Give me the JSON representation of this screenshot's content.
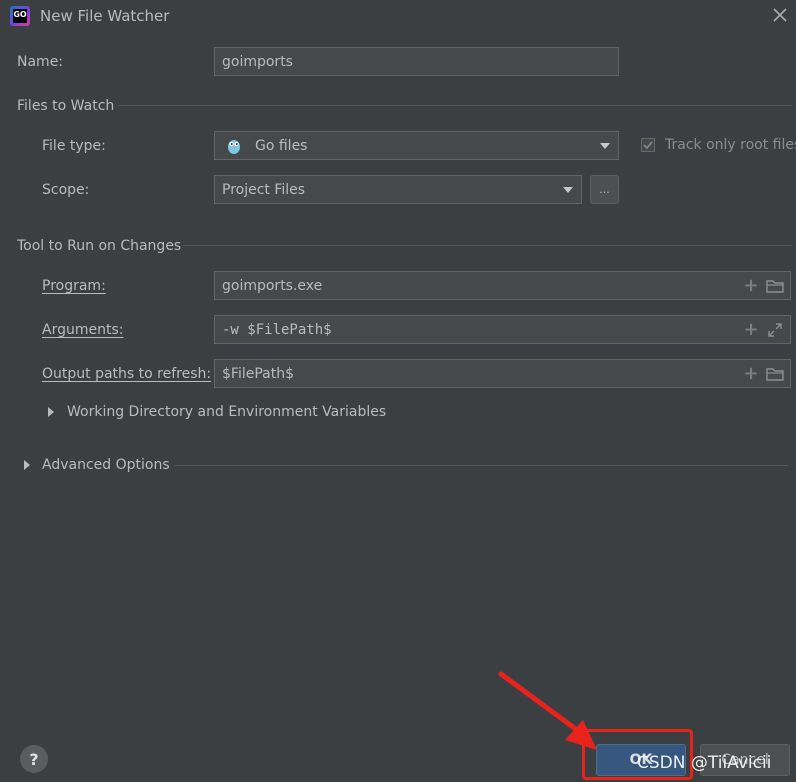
{
  "window": {
    "title": "New File Watcher",
    "logo_text": "GO",
    "close_icon": "close-icon"
  },
  "name_row": {
    "label": "Name:",
    "value": "goimports"
  },
  "files_to_watch": {
    "section_title": "Files to Watch",
    "file_type": {
      "label": "File type:",
      "value": "Go files",
      "icon": "gopher-icon"
    },
    "track_root": {
      "label": "Track only root files",
      "checked": true
    },
    "scope": {
      "label": "Scope:",
      "value": "Project Files",
      "browse_label": "..."
    }
  },
  "tool_to_run": {
    "section_title": "Tool to Run on Changes",
    "program": {
      "label": "Program:",
      "value": "goimports.exe"
    },
    "arguments": {
      "label": "Arguments:",
      "value": "-w $FilePath$"
    },
    "output_paths": {
      "label": "Output paths to refresh:",
      "value": "$FilePath$"
    },
    "working_dir": {
      "label": "Working Directory and Environment Variables"
    }
  },
  "advanced_options": {
    "label": "Advanced Options"
  },
  "footer": {
    "help_label": "?",
    "ok_label": "OK",
    "cancel_label": "Cancel"
  },
  "overlay": {
    "watermark": "CSDN @TiiAvicii",
    "annotation_color": "#e8231b"
  },
  "colors": {
    "background": "#3c3f41",
    "field_bg": "#45494a",
    "ok_bg": "#365880"
  }
}
